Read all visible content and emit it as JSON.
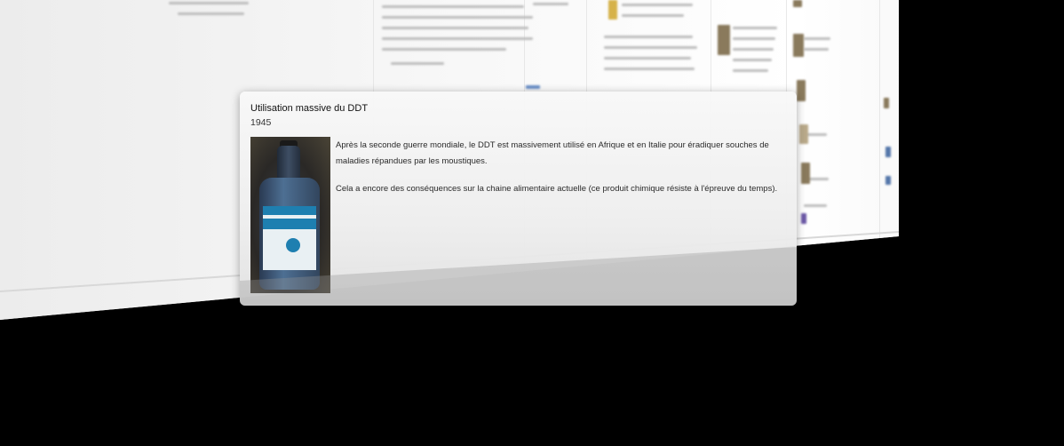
{
  "event": {
    "title": "Utilisation massive du DDT",
    "date": "1945",
    "paragraphs": [
      "Après la seconde guerre mondiale, le DDT est massivement utilisé en Afrique et en Italie pour éradiquer souches de maladies répandues par les moustiques.",
      "Cela a encore des conséquences sur la chaine alimentaire actuelle (ce produit chimique résiste à l'épreuve du temps)."
    ],
    "image_icon": "ddt-bottle-photo"
  },
  "colors": {
    "background": "#000000",
    "wall": "#f3f3f3",
    "card": "#efefef",
    "label_blue": "#1e7fb0"
  }
}
